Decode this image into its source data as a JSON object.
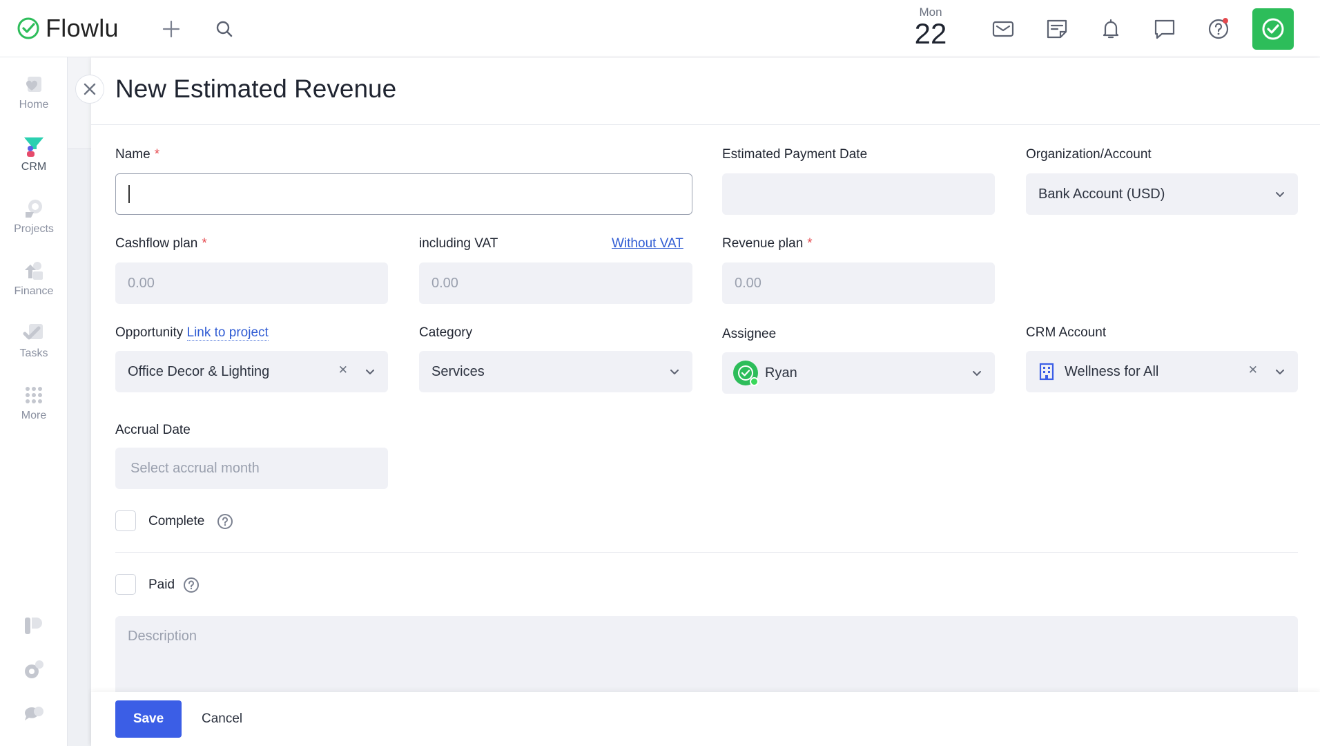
{
  "app": {
    "name": "Flowlu"
  },
  "topbar": {
    "date_weekday": "Mon",
    "date_day": "22"
  },
  "sidebar": {
    "items": [
      {
        "label": "Home"
      },
      {
        "label": "CRM"
      },
      {
        "label": "Projects"
      },
      {
        "label": "Finance"
      },
      {
        "label": "Tasks"
      },
      {
        "label": "More"
      }
    ]
  },
  "form": {
    "title": "New Estimated Revenue",
    "name": {
      "label": "Name",
      "value": ""
    },
    "estimated_payment_date": {
      "label": "Estimated Payment Date",
      "value": ""
    },
    "organization_account": {
      "label": "Organization/Account",
      "value": "Bank Account (USD)"
    },
    "cashflow_plan": {
      "label": "Cashflow plan",
      "placeholder": "0.00"
    },
    "including_vat": {
      "label": "including VAT",
      "link": "Without VAT",
      "placeholder": "0.00"
    },
    "revenue_plan": {
      "label": "Revenue plan",
      "placeholder": "0.00"
    },
    "opportunity": {
      "label": "Opportunity",
      "link": "Link to project",
      "value": "Office Decor & Lighting"
    },
    "category": {
      "label": "Category",
      "value": "Services"
    },
    "assignee": {
      "label": "Assignee",
      "value": "Ryan"
    },
    "crm_account": {
      "label": "CRM Account",
      "value": "Wellness for All"
    },
    "accrual_date": {
      "label": "Accrual Date",
      "placeholder": "Select accrual month"
    },
    "complete": {
      "label": "Complete",
      "checked": false
    },
    "paid": {
      "label": "Paid",
      "checked": false
    },
    "description": {
      "placeholder": "Description"
    }
  },
  "footer": {
    "save_label": "Save",
    "cancel_label": "Cancel"
  },
  "colors": {
    "accent": "#3b5ee6",
    "brand_green": "#2dbd5a",
    "required": "#e5484d",
    "link": "#2f5bd3"
  }
}
